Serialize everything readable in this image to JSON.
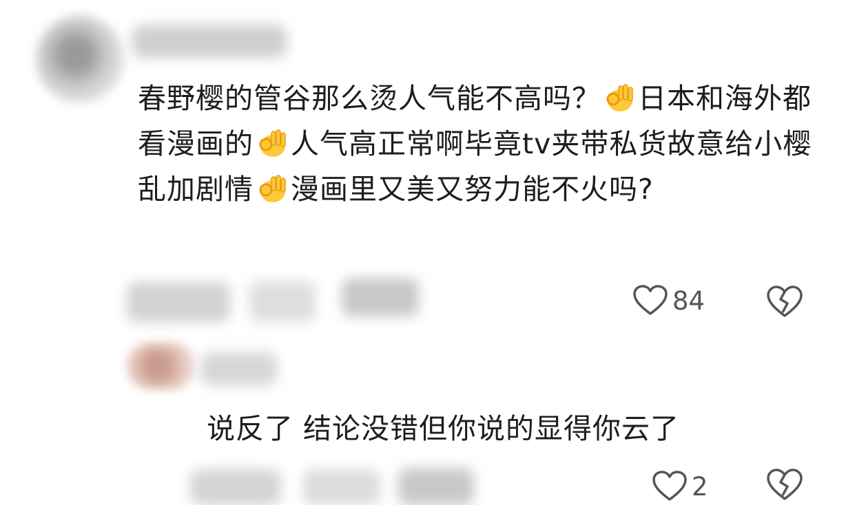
{
  "comments": [
    {
      "text_segments": [
        {
          "text": "春野樱的管谷那么烫人气能不高吗？",
          "emoji_after": "ok-hand-emoji"
        },
        {
          "text": "日本和海外都看漫画的",
          "emoji_after": "ok-hand-emoji"
        },
        {
          "text": "人气高正常啊毕竟tv夹带私货故意给小樱乱加剧情",
          "emoji_after": "ok-hand-emoji"
        },
        {
          "text": "漫画里又美又努力能不火吗?",
          "emoji_after": ""
        }
      ],
      "likes": "84"
    },
    {
      "text_segments": [
        {
          "text": "说反了 结论没错但你说的显得你云了",
          "emoji_after": ""
        }
      ],
      "likes": "2"
    }
  ],
  "icons": {
    "like": "heart-outline-icon",
    "dislike": "broken-heart-icon",
    "emoji": "ok-hand-emoji"
  },
  "colors": {
    "text": "#1d1d1d",
    "meta": "#555555",
    "blur": "#d4d4d4"
  }
}
